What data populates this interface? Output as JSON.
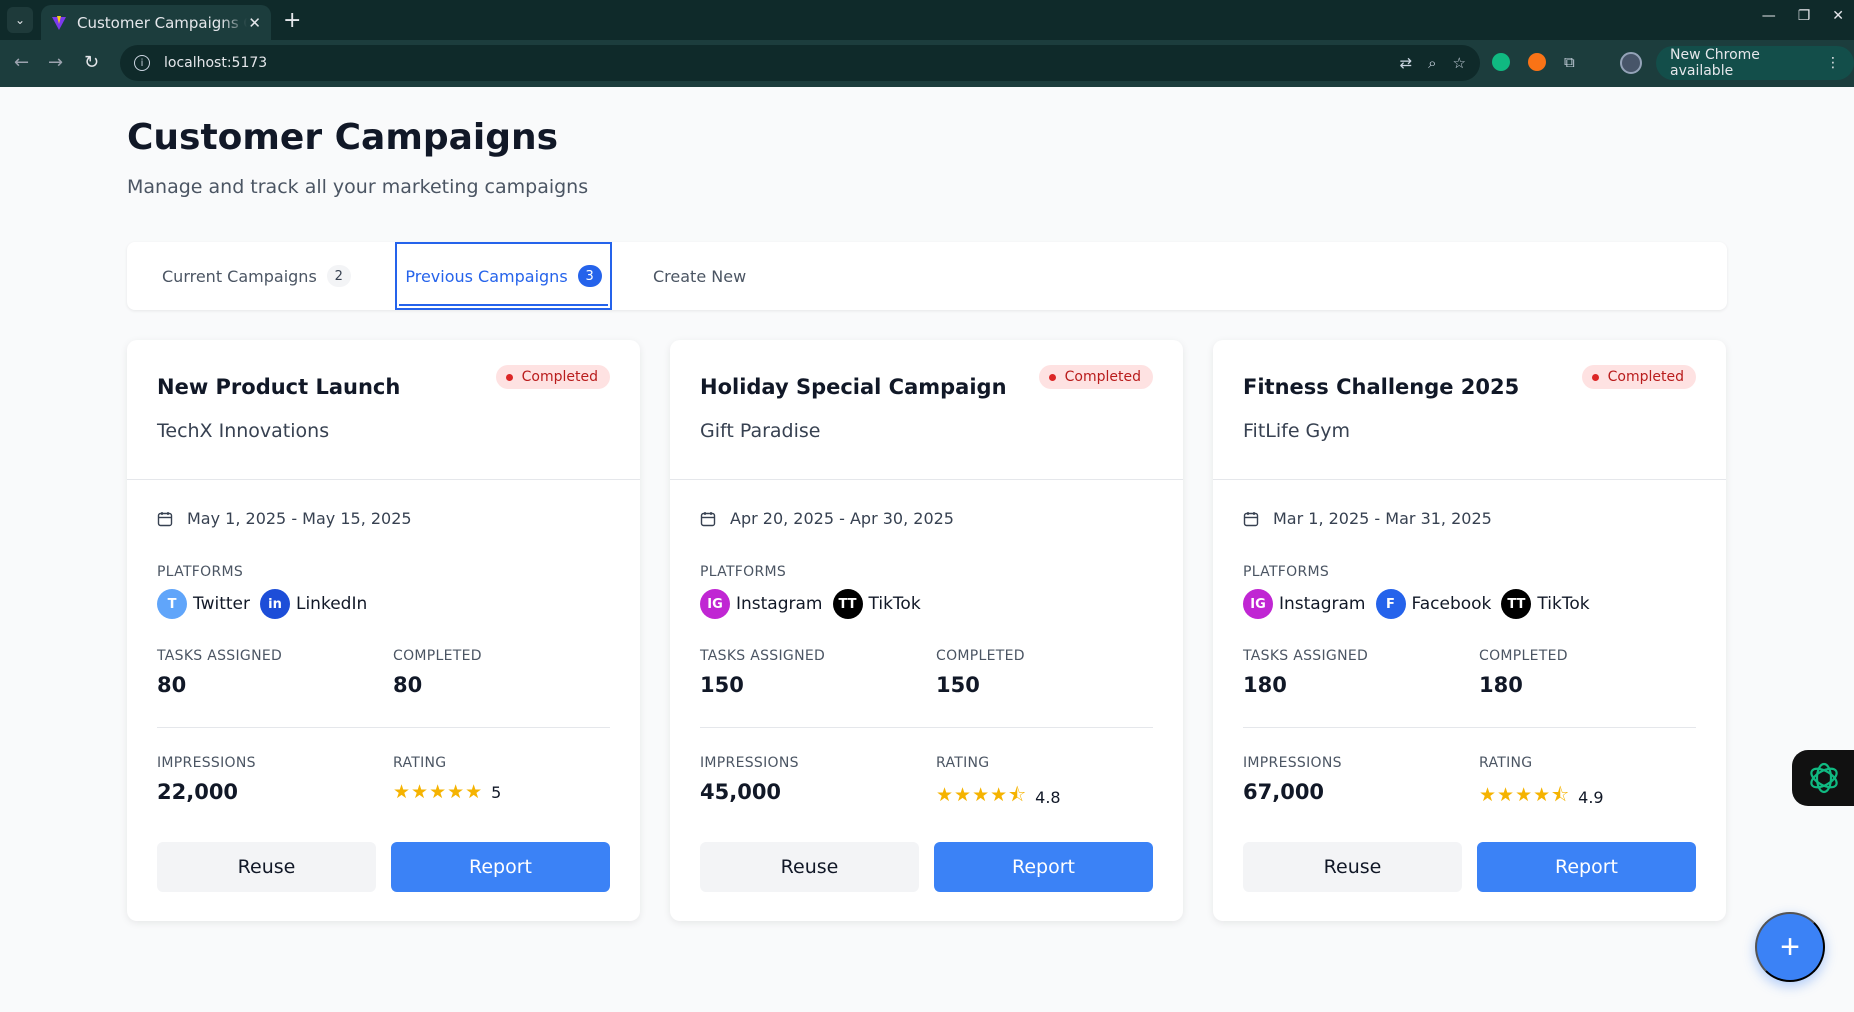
{
  "browser": {
    "tab_title": "Customer Campaigns Ov",
    "url": "localhost:5173",
    "update_label": "New Chrome available"
  },
  "page": {
    "title": "Customer Campaigns",
    "subtitle": "Manage and track all your marketing campaigns"
  },
  "tabs": [
    {
      "label": "Current Campaigns",
      "count": "2",
      "active": false
    },
    {
      "label": "Previous Campaigns",
      "count": "3",
      "active": true
    },
    {
      "label": "Create New",
      "count": null,
      "active": false
    }
  ],
  "labels": {
    "platforms": "PLATFORMS",
    "tasks_assigned": "TASKS ASSIGNED",
    "completed": "COMPLETED",
    "impressions": "IMPRESSIONS",
    "rating": "RATING",
    "reuse": "Reuse",
    "report": "Report"
  },
  "campaigns": [
    {
      "title": "New Product Launch",
      "client": "TechX Innovations",
      "status": "Completed",
      "dates": "May 1, 2025 - May 15, 2025",
      "platforms": [
        {
          "abbr": "T",
          "name": "Twitter",
          "color": "#60a5fa"
        },
        {
          "abbr": "in",
          "name": "LinkedIn",
          "color": "#1d4ed8"
        }
      ],
      "tasks_assigned": "80",
      "completed": "80",
      "impressions": "22,000",
      "rating": "5",
      "stars": "★★★★★"
    },
    {
      "title": "Holiday Special Campaign",
      "client": "Gift Paradise",
      "status": "Completed",
      "dates": "Apr 20, 2025 - Apr 30, 2025",
      "platforms": [
        {
          "abbr": "IG",
          "name": "Instagram",
          "color": "#c026d3"
        },
        {
          "abbr": "TT",
          "name": "TikTok",
          "color": "#000000"
        }
      ],
      "tasks_assigned": "150",
      "completed": "150",
      "impressions": "45,000",
      "rating": "4.8",
      "stars": "★★★★⯪"
    },
    {
      "title": "Fitness Challenge 2025",
      "client": "FitLife Gym",
      "status": "Completed",
      "dates": "Mar 1, 2025 - Mar 31, 2025",
      "platforms": [
        {
          "abbr": "IG",
          "name": "Instagram",
          "color": "#c026d3"
        },
        {
          "abbr": "F",
          "name": "Facebook",
          "color": "#2563eb"
        },
        {
          "abbr": "TT",
          "name": "TikTok",
          "color": "#000000"
        }
      ],
      "tasks_assigned": "180",
      "completed": "180",
      "impressions": "67,000",
      "rating": "4.9",
      "stars": "★★★★⯪"
    }
  ],
  "fab_label": "+"
}
